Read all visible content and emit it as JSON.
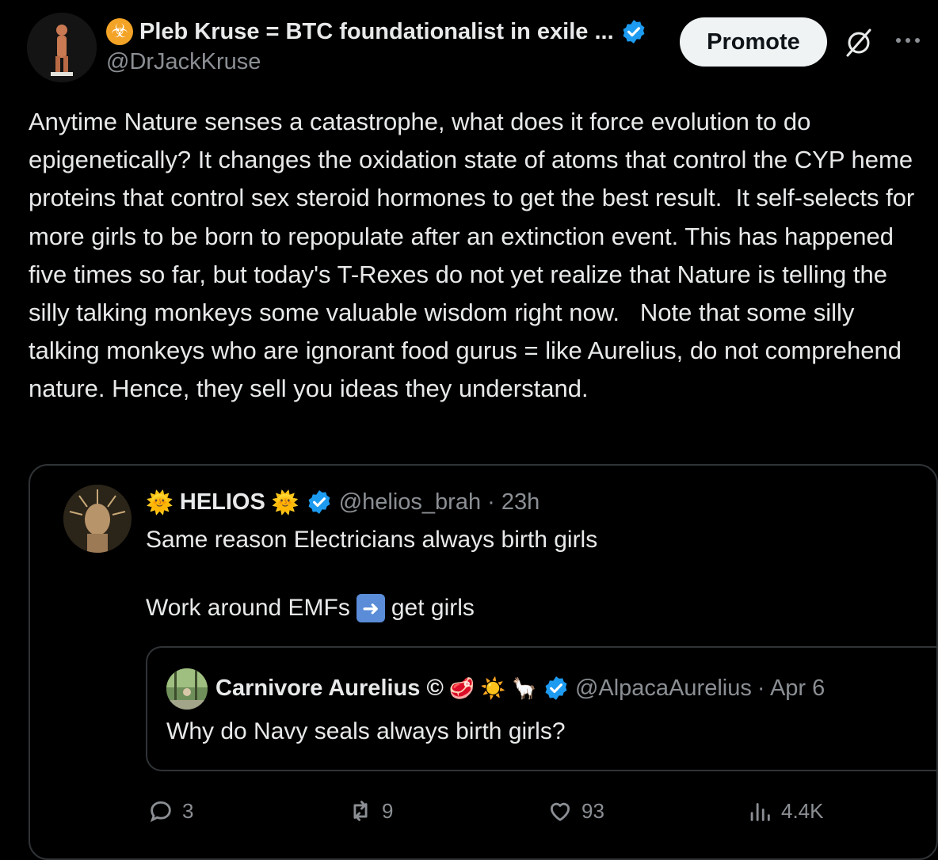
{
  "author": {
    "display_name": "Pleb Kruse = BTC foundationalist in exile ...",
    "handle": "@DrJackKruse",
    "biohazard_icon": "biohazard-icon"
  },
  "header": {
    "promote_label": "Promote"
  },
  "tweet": {
    "text": "Anytime Nature senses a catastrophe, what does it force evolution to do epigenetically? It changes the oxidation state of atoms that control the CYP heme proteins that control sex steroid hormones to get the best result.  It self-selects for more girls to be born to repopulate after an extinction event. This has happened five times so far, but today's T-Rexes do not yet realize that Nature is telling the silly talking monkeys some valuable wisdom right now.   Note that some silly talking monkeys who are ignorant food gurus = like Aurelius, do not comprehend nature. Hence, they sell you ideas they understand."
  },
  "quoted": {
    "name": "HELIOS",
    "handle": "@helios_brah",
    "time": "· 23h",
    "line1": "Same reason Electricians always birth girls",
    "line2_pre": "Work around EMFs",
    "line2_post": "get girls"
  },
  "nested": {
    "name": "Carnivore Aurelius ©",
    "handle": "@AlpacaAurelius",
    "date": "· Apr 6",
    "text": "Why do Navy seals always birth girls?"
  },
  "actions": {
    "replies": "3",
    "reposts": "9",
    "likes": "93",
    "views": "4.4K"
  },
  "colors": {
    "background": "#000000",
    "verified": "#1d9bf0",
    "secondary_text": "#8b8f94"
  }
}
